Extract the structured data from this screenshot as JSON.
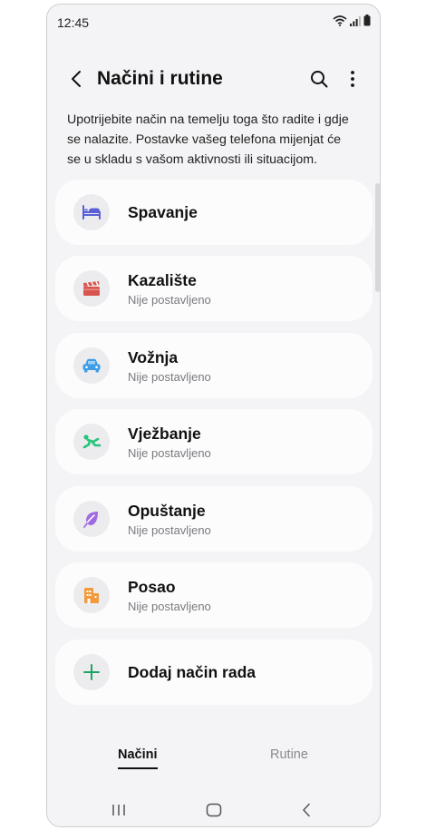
{
  "status_bar": {
    "time": "12:45"
  },
  "header": {
    "title": "Načini i rutine"
  },
  "description": "Upotrijebite način na temelju toga što radite i gdje se nalazite. Postavke vašeg telefona mijenjat će se u skladu s vašom aktivnosti ili situacijom.",
  "modes": [
    {
      "name": "Spavanje",
      "icon": "bed-icon",
      "color": "#5a5fd6"
    },
    {
      "name": "Kazalište",
      "status": "Nije postavljeno",
      "icon": "clapperboard-icon",
      "color": "#d9534f"
    },
    {
      "name": "Vožnja",
      "status": "Nije postavljeno",
      "icon": "car-icon",
      "color": "#3d9de6"
    },
    {
      "name": "Vježbanje",
      "status": "Nije postavljeno",
      "icon": "exercise-icon",
      "color": "#27c47a"
    },
    {
      "name": "Opuštanje",
      "status": "Nije postavljeno",
      "icon": "leaf-icon",
      "color": "#a06be0"
    },
    {
      "name": "Posao",
      "status": "Nije postavljeno",
      "icon": "building-icon",
      "color": "#f29a3b"
    }
  ],
  "add_mode": {
    "label": "Dodaj način rada",
    "icon": "plus-icon",
    "color": "#1fa463"
  },
  "tabs": {
    "active": "Načini",
    "inactive": "Rutine"
  }
}
